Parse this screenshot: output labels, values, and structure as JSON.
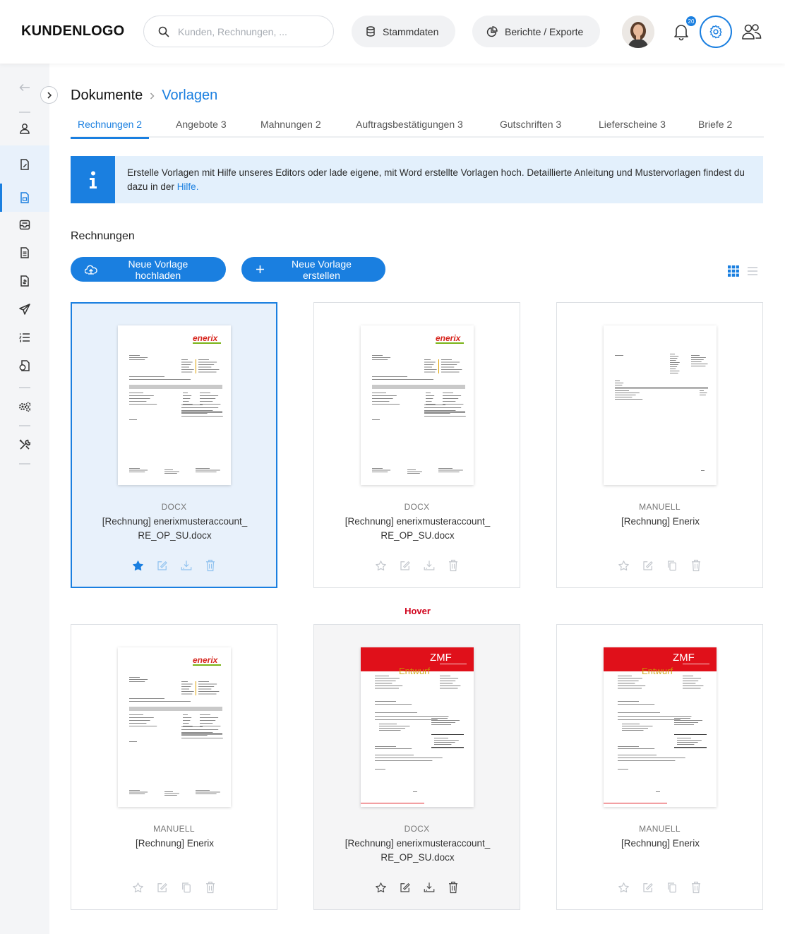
{
  "header": {
    "logo": "KUNDENLOGO",
    "search_placeholder": "Kunden, Rechnungen, ...",
    "stammdaten": "Stammdaten",
    "berichte": "Berichte / Exporte",
    "notifications": "20"
  },
  "breadcrumb": {
    "section": "Dokumente",
    "current": "Vorlagen"
  },
  "tabs": [
    "Rechnungen 2",
    "Angebote 3",
    "Mahnungen 2",
    "Auftragsbestätigungen 3",
    "Gutschriften 3",
    "Lieferscheine 3",
    "Briefe 2"
  ],
  "info": {
    "text": "Erstelle Vorlagen mit Hilfe unseres Editors oder lade eigene, mit Word erstellte Vorlagen hoch. Detaillierte Anleitung und Mustervorlagen findest du dazu in der ",
    "link": "Hilfe."
  },
  "section_title": "Rechnungen",
  "buttons": {
    "upload": "Neue Vorlage hochladen",
    "create": "Neue Vorlage erstellen"
  },
  "hover_label": "Hover",
  "cards": [
    {
      "type": "DOCX",
      "name": "[Rechnung] enerixmusteraccount_ RE_OP_SU.docx",
      "thumb": "enerix",
      "starred": true,
      "third_icon": "download-icon"
    },
    {
      "type": "DOCX",
      "name": "[Rechnung] enerixmusteraccount_ RE_OP_SU.docx",
      "thumb": "enerix",
      "starred": false,
      "third_icon": "download-icon"
    },
    {
      "type": "MANUELL",
      "name": "[Rechnung] Enerix",
      "thumb": "plain",
      "starred": false,
      "third_icon": "copy-icon"
    },
    {
      "type": "MANUELL",
      "name": "[Rechnung] Enerix",
      "thumb": "enerix",
      "starred": false,
      "third_icon": "copy-icon"
    },
    {
      "type": "DOCX",
      "name": "[Rechnung] enerixmusteraccount_ RE_OP_SU.docx",
      "thumb": "zmf",
      "starred": false,
      "third_icon": "download-icon"
    },
    {
      "type": "MANUELL",
      "name": "[Rechnung] Enerix",
      "thumb": "zmf",
      "starred": false,
      "third_icon": "copy-icon"
    }
  ],
  "thumb_text": {
    "enerix_logo": "enerix",
    "zmf_logo": "ZMF",
    "zmf_draft": "Entwurf"
  },
  "colors": {
    "accent": "#1a7fe0",
    "hover_label": "#d0021b",
    "zmf_red": "#e0101a",
    "enerix_red": "#d7261e",
    "enerix_green": "#7ab317"
  }
}
